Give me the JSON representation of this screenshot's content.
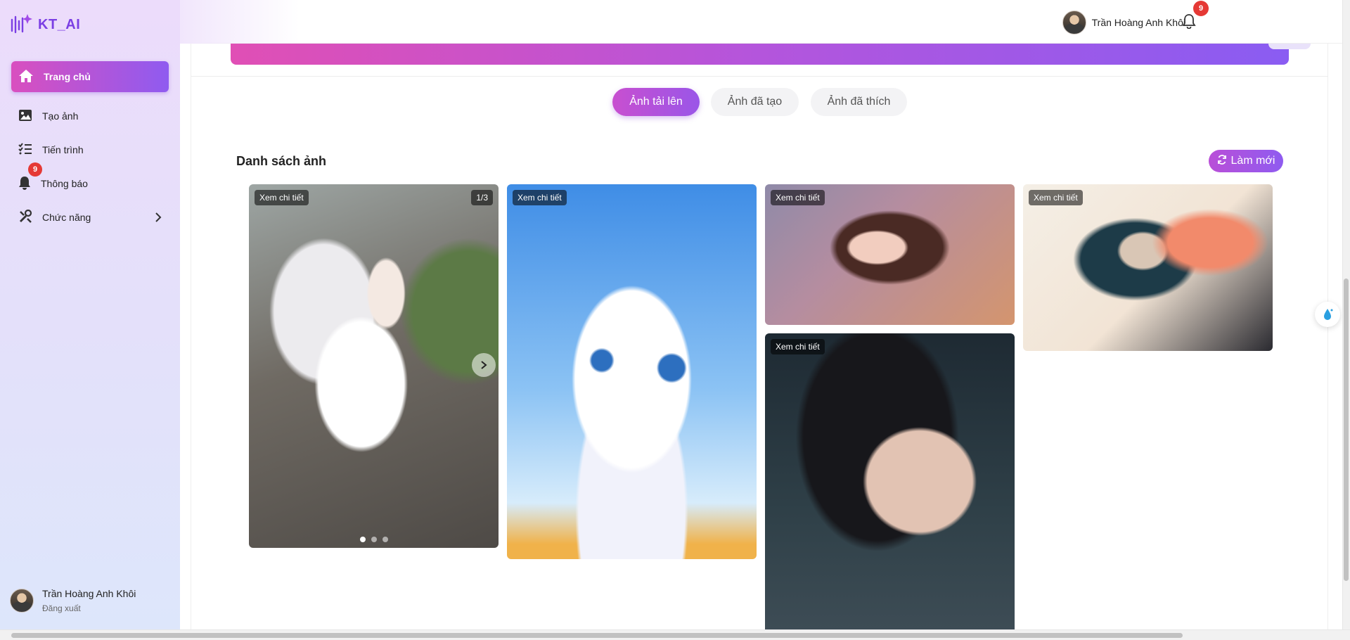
{
  "app": {
    "logo_text": "KT_AI"
  },
  "sidebar": {
    "items": [
      {
        "label": "Trang chủ",
        "icon": "home-icon",
        "active": true
      },
      {
        "label": "Tạo ảnh",
        "icon": "image-icon"
      },
      {
        "label": "Tiến trình",
        "icon": "list-check-icon"
      },
      {
        "label": "Thông báo",
        "icon": "bell-icon",
        "badge": "9"
      },
      {
        "label": "Chức năng",
        "icon": "tools-icon"
      }
    ],
    "user": {
      "name": "Trần Hoàng Anh Khôi",
      "logout": "Đăng xuất"
    }
  },
  "header": {
    "user_name": "Trần Hoàng Anh Khôi",
    "notification_count": "9"
  },
  "tabs": [
    {
      "label": "Ảnh tải lên",
      "active": true
    },
    {
      "label": "Ảnh đã tạo"
    },
    {
      "label": "Ảnh đã thích"
    }
  ],
  "gallery": {
    "title": "Danh sách ảnh",
    "refresh_label": "Làm mới",
    "detail_label": "Xem chi tiết",
    "first_card_counter": "1/3",
    "first_card_slides": 3,
    "first_card_current_slide": 1
  },
  "colors": {
    "accent_pink": "#d94fbf",
    "accent_purple": "#8f5bf0",
    "badge_red": "#e53935"
  }
}
